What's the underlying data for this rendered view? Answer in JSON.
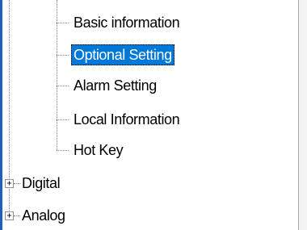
{
  "tree": {
    "children": [
      {
        "label": "Basic information",
        "selected": false
      },
      {
        "label": "Optional Setting",
        "selected": true
      },
      {
        "label": "Alarm Setting",
        "selected": false
      },
      {
        "label": "Local Information",
        "selected": false
      },
      {
        "label": "Hot Key",
        "selected": false
      }
    ],
    "roots": [
      {
        "label": "Digital",
        "expander": "+"
      },
      {
        "label": "Analog",
        "expander": "+"
      }
    ]
  },
  "colors": {
    "selection": "#0078d7",
    "accent": "#1f5fbf"
  }
}
